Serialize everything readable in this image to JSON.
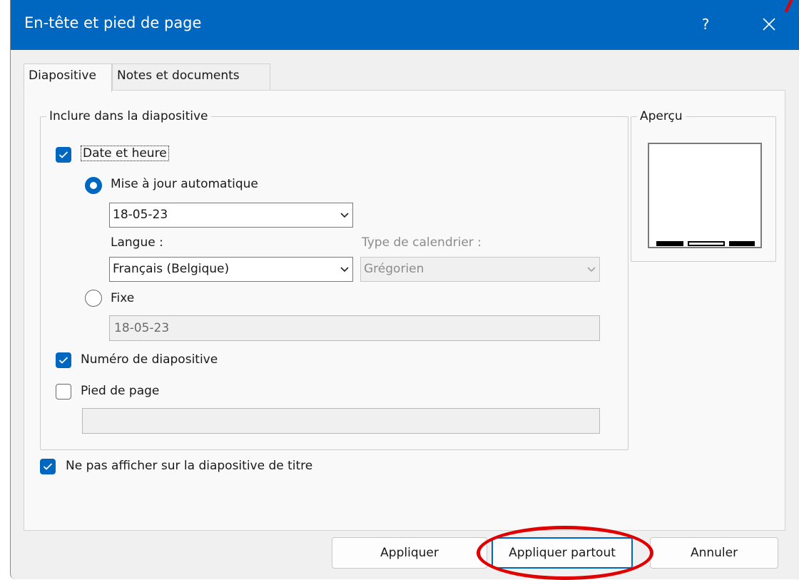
{
  "dialog": {
    "title": "En-tête et pied de page",
    "help_label": "?",
    "close_icon": "close-icon"
  },
  "tabs": [
    {
      "label": "Diapositive",
      "active": true
    },
    {
      "label": "Notes et documents",
      "active": false
    }
  ],
  "include_group": {
    "legend": "Inclure dans la diapositive",
    "date_time": {
      "label": "Date et heure",
      "checked": true
    },
    "auto_update": {
      "label": "Mise à jour automatique",
      "selected": true,
      "date_value": "18-05-23"
    },
    "language": {
      "label": "Langue :",
      "value": "Français (Belgique)"
    },
    "calendar_type": {
      "label": "Type de calendrier :",
      "value": "Grégorien",
      "disabled": true
    },
    "fixed": {
      "label": "Fixe",
      "selected": false,
      "value": "18-05-23"
    },
    "slide_number": {
      "label": "Numéro de diapositive",
      "checked": true
    },
    "footer": {
      "label": "Pied de page",
      "checked": false,
      "value": ""
    }
  },
  "hide_on_title": {
    "label": "Ne pas afficher sur la diapositive de titre",
    "checked": true
  },
  "preview": {
    "legend": "Aperçu"
  },
  "buttons": {
    "apply": "Appliquer",
    "apply_all": "Appliquer partout",
    "cancel": "Annuler"
  },
  "colors": {
    "accent": "#0067c0",
    "annotation": "#e00000"
  }
}
